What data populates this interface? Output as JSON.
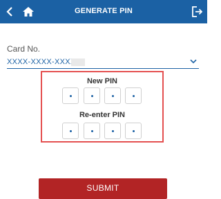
{
  "header": {
    "title": "GENERATE PIN",
    "background": "#1b61a4"
  },
  "card": {
    "label": "Card No.",
    "value": "XXXX-XXXX-XXXX-("
  },
  "pin": {
    "new_label": "New PIN",
    "reenter_label": "Re-enter PIN",
    "digits_per_field": 4
  },
  "actions": {
    "submit_label": "SUBMIT"
  },
  "colors": {
    "accent": "#1b61a4",
    "highlight": "#e44f4f",
    "submit": "#b22425"
  },
  "icons": {
    "back": "chevron-left-icon",
    "home": "home-icon",
    "logout": "logout-icon",
    "dropdown": "chevron-down-icon"
  }
}
